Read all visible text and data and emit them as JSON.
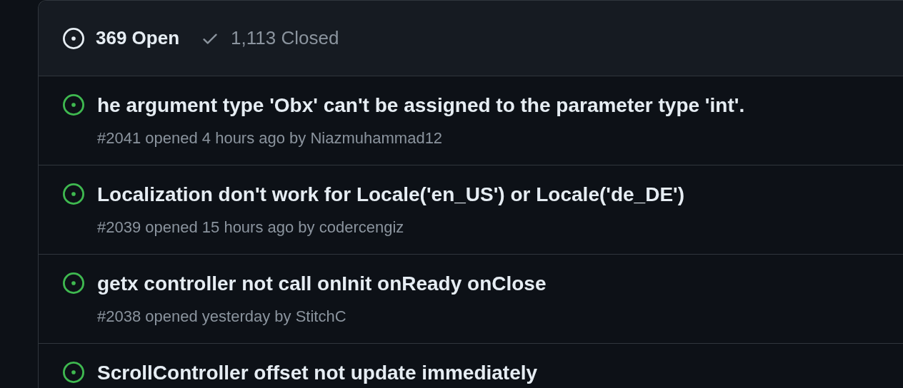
{
  "tabs": [
    {
      "kind": "open",
      "label": "369 Open",
      "selected": true
    },
    {
      "kind": "closed",
      "label": "1,113 Closed",
      "selected": false
    }
  ],
  "issues": [
    {
      "title": "he argument type 'Obx' can't be assigned to the parameter type 'int'.",
      "meta": "#2041 opened 4 hours ago by Niazmuhammad12"
    },
    {
      "title": "Localization don't work for Locale('en_US') or Locale('de_DE')",
      "meta": "#2039 opened 15 hours ago by codercengiz"
    },
    {
      "title": "getx controller not call onInit onReady onClose",
      "meta": "#2038 opened yesterday by StitchC"
    },
    {
      "title": "ScrollController offset not update immediately"
    }
  ]
}
